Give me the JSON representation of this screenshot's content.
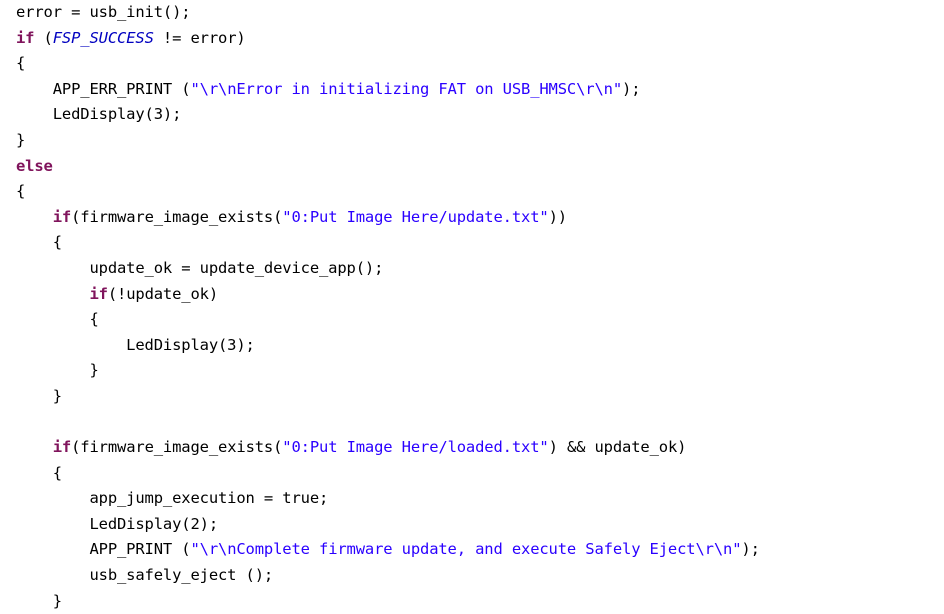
{
  "editor": {
    "background_color": "#ffffff",
    "default_text_color": "#000000",
    "keyword_color": "#80145c",
    "string_color": "#2a00ff",
    "macro_color": "#0000c0",
    "language": "C",
    "indent_width": 4
  },
  "code": {
    "lines": [
      {
        "index": 0,
        "text": "error = usb_init();",
        "tokens": [
          {
            "text": "error = usb_init();",
            "type": "plain"
          }
        ]
      },
      {
        "index": 1,
        "text": "if (FSP_SUCCESS != error)",
        "tokens": [
          {
            "text": "if",
            "type": "keyword"
          },
          {
            "text": " (",
            "type": "plain"
          },
          {
            "text": "FSP_SUCCESS",
            "type": "macro"
          },
          {
            "text": " != error)",
            "type": "plain"
          }
        ]
      },
      {
        "index": 2,
        "text": "{",
        "tokens": [
          {
            "text": "{",
            "type": "plain"
          }
        ]
      },
      {
        "index": 3,
        "text": "    APP_ERR_PRINT (\"\\r\\nError in initializing FAT on USB_HMSC\\r\\n\");",
        "tokens": [
          {
            "text": "    APP_ERR_PRINT (",
            "type": "plain"
          },
          {
            "text": "\"\\r\\nError in initializing FAT on USB_HMSC\\r\\n\"",
            "type": "string"
          },
          {
            "text": ");",
            "type": "plain"
          }
        ]
      },
      {
        "index": 4,
        "text": "    LedDisplay(3);",
        "tokens": [
          {
            "text": "    LedDisplay(3);",
            "type": "plain"
          }
        ]
      },
      {
        "index": 5,
        "text": "}",
        "tokens": [
          {
            "text": "}",
            "type": "plain"
          }
        ]
      },
      {
        "index": 6,
        "text": "else",
        "tokens": [
          {
            "text": "else",
            "type": "keyword"
          }
        ]
      },
      {
        "index": 7,
        "text": "{",
        "tokens": [
          {
            "text": "{",
            "type": "plain"
          }
        ]
      },
      {
        "index": 8,
        "text": "    if(firmware_image_exists(\"0:Put Image Here/update.txt\"))",
        "tokens": [
          {
            "text": "    ",
            "type": "plain"
          },
          {
            "text": "if",
            "type": "keyword"
          },
          {
            "text": "(firmware_image_exists(",
            "type": "plain"
          },
          {
            "text": "\"0:Put Image Here/update.txt\"",
            "type": "string"
          },
          {
            "text": "))",
            "type": "plain"
          }
        ]
      },
      {
        "index": 9,
        "text": "    {",
        "tokens": [
          {
            "text": "    {",
            "type": "plain"
          }
        ]
      },
      {
        "index": 10,
        "text": "        update_ok = update_device_app();",
        "tokens": [
          {
            "text": "        update_ok = update_device_app();",
            "type": "plain"
          }
        ]
      },
      {
        "index": 11,
        "text": "        if(!update_ok)",
        "tokens": [
          {
            "text": "        ",
            "type": "plain"
          },
          {
            "text": "if",
            "type": "keyword"
          },
          {
            "text": "(!update_ok)",
            "type": "plain"
          }
        ]
      },
      {
        "index": 12,
        "text": "        {",
        "tokens": [
          {
            "text": "        {",
            "type": "plain"
          }
        ]
      },
      {
        "index": 13,
        "text": "            LedDisplay(3);",
        "tokens": [
          {
            "text": "            LedDisplay(3);",
            "type": "plain"
          }
        ]
      },
      {
        "index": 14,
        "text": "        }",
        "tokens": [
          {
            "text": "        }",
            "type": "plain"
          }
        ]
      },
      {
        "index": 15,
        "text": "    }",
        "tokens": [
          {
            "text": "    }",
            "type": "plain"
          }
        ]
      },
      {
        "index": 16,
        "text": "",
        "tokens": [
          {
            "text": " ",
            "type": "blank"
          }
        ]
      },
      {
        "index": 17,
        "text": "    if(firmware_image_exists(\"0:Put Image Here/loaded.txt\") && update_ok)",
        "tokens": [
          {
            "text": "    ",
            "type": "plain"
          },
          {
            "text": "if",
            "type": "keyword"
          },
          {
            "text": "(firmware_image_exists(",
            "type": "plain"
          },
          {
            "text": "\"0:Put Image Here/loaded.txt\"",
            "type": "string"
          },
          {
            "text": ") && update_ok)",
            "type": "plain"
          }
        ]
      },
      {
        "index": 18,
        "text": "    {",
        "tokens": [
          {
            "text": "    {",
            "type": "plain"
          }
        ]
      },
      {
        "index": 19,
        "text": "        app_jump_execution = true;",
        "tokens": [
          {
            "text": "        app_jump_execution = true;",
            "type": "plain"
          }
        ]
      },
      {
        "index": 20,
        "text": "        LedDisplay(2);",
        "tokens": [
          {
            "text": "        LedDisplay(2);",
            "type": "plain"
          }
        ]
      },
      {
        "index": 21,
        "text": "        APP_PRINT (\"\\r\\nComplete firmware update, and execute Safely Eject\\r\\n\");",
        "tokens": [
          {
            "text": "        APP_PRINT (",
            "type": "plain"
          },
          {
            "text": "\"\\r\\nComplete firmware update, and execute Safely Eject\\r\\n\"",
            "type": "string"
          },
          {
            "text": ");",
            "type": "plain"
          }
        ]
      },
      {
        "index": 22,
        "text": "        usb_safely_eject ();",
        "tokens": [
          {
            "text": "        usb_safely_eject ();",
            "type": "plain"
          }
        ]
      },
      {
        "index": 23,
        "text": "    }",
        "tokens": [
          {
            "text": "    }",
            "type": "plain"
          }
        ]
      }
    ]
  }
}
